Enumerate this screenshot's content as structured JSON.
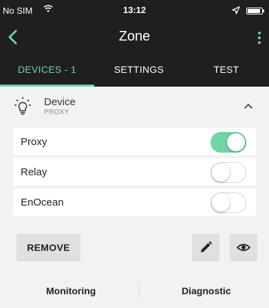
{
  "status_bar": {
    "carrier": "No SIM",
    "time": "13:12",
    "icons": [
      "wifi-icon",
      "location-icon",
      "battery-icon"
    ]
  },
  "app_bar": {
    "title": "Zone",
    "icons": [
      "back-arrow-icon",
      "more-vert-icon"
    ]
  },
  "tabs": [
    {
      "label": "DEVICES - 1",
      "active": true
    },
    {
      "label": "SETTINGS",
      "active": false
    },
    {
      "label": "TEST",
      "active": false
    }
  ],
  "device": {
    "name": "Device",
    "type": "PROXY",
    "icon": "lightbulb-icon",
    "expanded": true
  },
  "settings_rows": [
    {
      "label": "Proxy",
      "on": true
    },
    {
      "label": "Relay",
      "on": false
    },
    {
      "label": "EnOcean",
      "on": false
    }
  ],
  "actions": {
    "remove_label": "REMOVE",
    "icons": [
      "pencil-icon",
      "eye-icon"
    ]
  },
  "bottom_bar": {
    "monitoring_label": "Monitoring",
    "diagnostic_label": "Diagnostic"
  },
  "colors": {
    "accent": "#6fd4a6",
    "header_bg": "#1f1f1f",
    "page_bg": "#f2f2f2"
  }
}
